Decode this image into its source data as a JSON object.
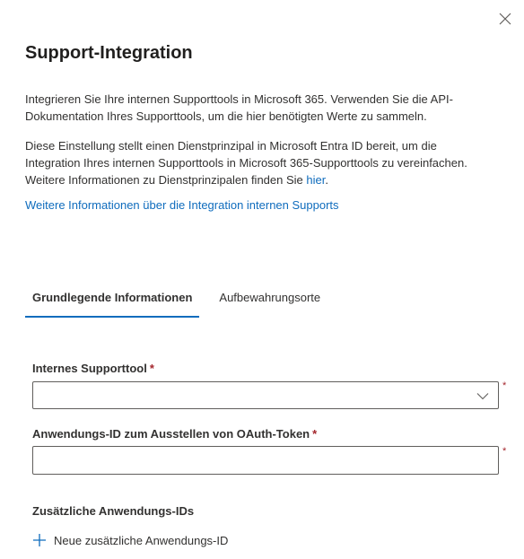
{
  "panel": {
    "title": "Support-Integration",
    "close_icon": "close-icon",
    "description_1": "Integrieren Sie Ihre internen Supporttools in Microsoft 365. Verwenden Sie die API-Dokumentation Ihres Supporttools, um die hier benötigten Werte zu sammeln.",
    "description_2_text": "Diese Einstellung stellt einen Dienstprinzipal in Microsoft Entra ID bereit, um die Integration Ihres internen Supporttools in Microsoft 365-Supporttools zu vereinfachen. Weitere Informationen zu Dienstprinzipalen finden Sie ",
    "description_2_link": "hier",
    "description_2_end": ".",
    "more_info_link": "Weitere Informationen über die Integration internen Supports"
  },
  "tabs": [
    {
      "label": "Grundlegende Informationen",
      "active": true
    },
    {
      "label": "Aufbewahrungsorte",
      "active": false
    }
  ],
  "form": {
    "support_tool": {
      "label": "Internes Supporttool",
      "required_marker": "*",
      "value": ""
    },
    "app_id": {
      "label": "Anwendungs-ID zum Ausstellen von OAuth-Token",
      "required_marker": "*",
      "value": ""
    },
    "additional_ids": {
      "label": "Zusätzliche Anwendungs-IDs",
      "add_button_label": "Neue zusätzliche Anwendungs-ID"
    }
  },
  "colors": {
    "accent": "#0f6cbd",
    "required": "#a4262c",
    "text": "#323130"
  }
}
